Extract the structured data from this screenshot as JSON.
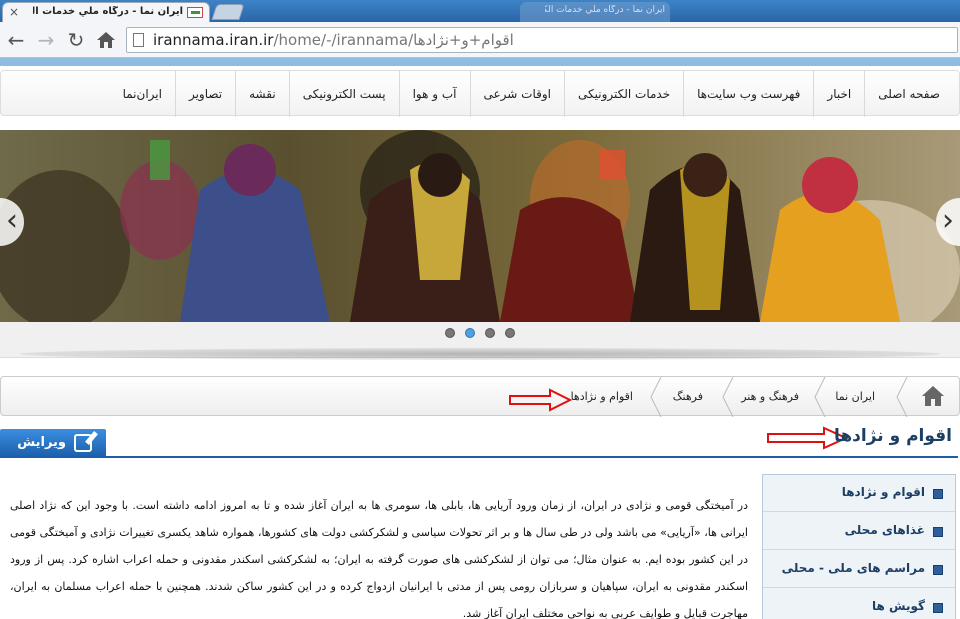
{
  "browser": {
    "tab_title": "ایران نما - درگاه ملي خدمات الكتر",
    "background_tab_title": "ایران نما - درگاه ملي خدمات الکترونیکی",
    "url_domain": "irannama.iran.ir",
    "url_path": "/home/-/irannama/اقوام+و+نژادها"
  },
  "nav": {
    "items": [
      "صفحه اصلی",
      "اخبار",
      "فهرست وب سایت‌ها",
      "خدمات الکترونیکی",
      "اوقات شرعی",
      "آب و هوا",
      "پست الکترونیکی",
      "نقشه",
      "تصاویر",
      "ایران‌نما"
    ]
  },
  "slider": {
    "dot_count": 4,
    "active_dot": 2
  },
  "breadcrumb": {
    "items": [
      "ایران نما",
      "فرهنگ و هنر",
      "فرهنگ",
      "اقوام و نژادها"
    ]
  },
  "page": {
    "edit_label": "ویرایش",
    "title": "اقوام و نژادها"
  },
  "sidebar": {
    "items": [
      "اقوام و نژادها",
      "غذاهای محلی",
      "مراسم های ملی - محلی",
      "گویش ها"
    ]
  },
  "article": {
    "text": "در آمیختگی قومی و نژادی در ایران، از زمان ورود آریایی ها، بابلی ها، سومری ها به ایران آغاز شده و تا به امروز ادامه داشته است. با وجود این که نژاد اصلی ایرانی ها، «آریایی» می باشد ولی در طی سال ها و بر اثر تحولات سیاسی و لشکرکشی دولت های کشورها، همواره شاهد یکسری تغییرات نژادی و آمیختگی قومی در این کشور بوده ایم. به عنوان مثال؛ می توان از لشکرکشی های صورت گرفته به ایران؛ به لشکرکشی اسکندر مقدونی و حمله اعراب اشاره کرد. پس از ورود اسکندر مقدونی به ایران، سپاهیان و سربازان رومی پس از مدتی با ایرانیان ازدواج کرده و در این کشور ساکن شدند. همچنین با حمله اعراب مسلمان به ایران، مهاجرت قبایل و طوایف عربی به نواحی مختلف ایران آغاز شد."
  },
  "colors": {
    "accent_blue": "#1b5fab",
    "annotation_red": "#e01010",
    "stripe_blue": "#8fbde0"
  }
}
